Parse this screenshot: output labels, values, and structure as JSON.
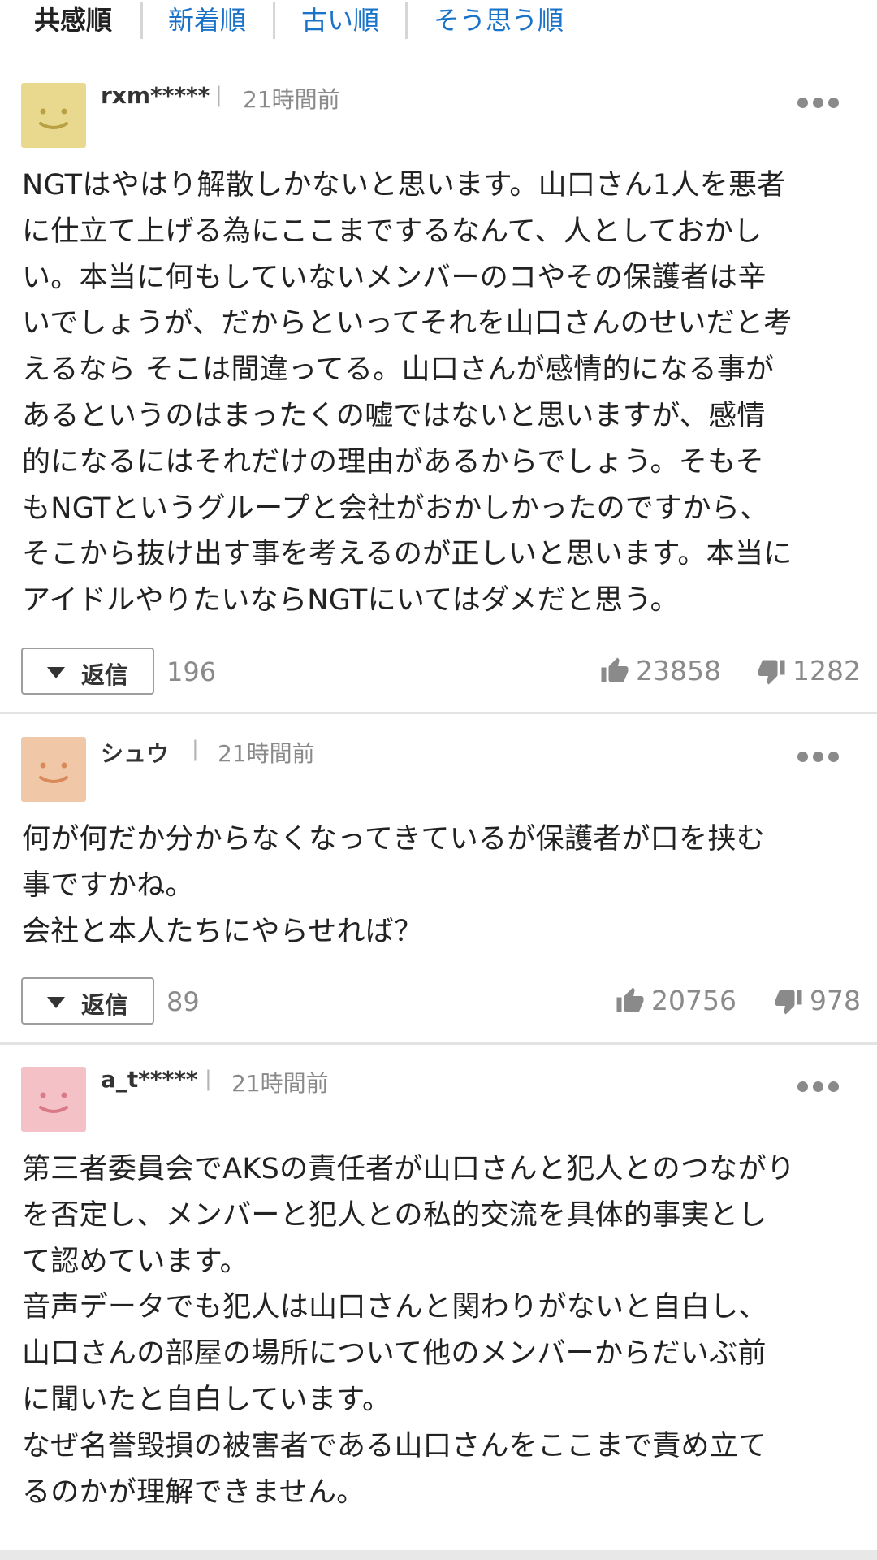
{
  "sort_tabs": [
    {
      "label": "共感順",
      "active": true
    },
    {
      "label": "新着順",
      "active": false
    },
    {
      "label": "古い順",
      "active": false
    },
    {
      "label": "そう思う順",
      "active": false
    }
  ],
  "comments": [
    {
      "avatar_color": "#e8d98e",
      "face_color": "#b8a043",
      "username": "rxm*****",
      "time": "21時間前",
      "body": "NGTはやはり解散しかないと思います。山口さん1人を悪者\nに仕立て上げる為にここまでするなんて、人としておかし\nい。本当に何もしていないメンバーのコやその保護者は辛\nいでしょうが、だからといってそれを山口さんのせいだと考\nえるなら そこは間違ってる。山口さんが感情的になる事が\nあるというのはまったくの嘘ではないと思いますが、感情\n的になるにはそれだけの理由があるからでしょう。そもそ\nもNGTというグループと会社がおかしかったのですから、\nそこから抜け出す事を考えるのが正しいと思います。本当に\nアイドルやりたいならNGTにいてはダメだと思う。",
      "reply_label": "返信",
      "reply_count": "196",
      "likes": "23858",
      "dislikes": "1282"
    },
    {
      "avatar_color": "#f0c8a8",
      "face_color": "#d9895a",
      "username": "シュウ",
      "time": "21時間前",
      "body": "何が何だか分からなくなってきているが保護者が口を挟む\n事ですかね。\n会社と本人たちにやらせれば？",
      "reply_label": "返信",
      "reply_count": "89",
      "likes": "20756",
      "dislikes": "978"
    },
    {
      "avatar_color": "#f3c1c6",
      "face_color": "#d97a86",
      "username": "a_t*****",
      "time": "21時間前",
      "body": "第三者委員会でAKSの責任者が山口さんと犯人とのつながり\nを否定し、メンバーと犯人との私的交流を具体的事実とし\nて認めています。\n音声データでも犯人は山口さんと関わりがないと自白し、\n山口さんの部屋の場所について他のメンバーからだいぶ前\nに聞いたと自白しています。\nなぜ名誉毀損の被害者である山口さんをここまで責め立て\nるのかが理解できません。"
    }
  ]
}
